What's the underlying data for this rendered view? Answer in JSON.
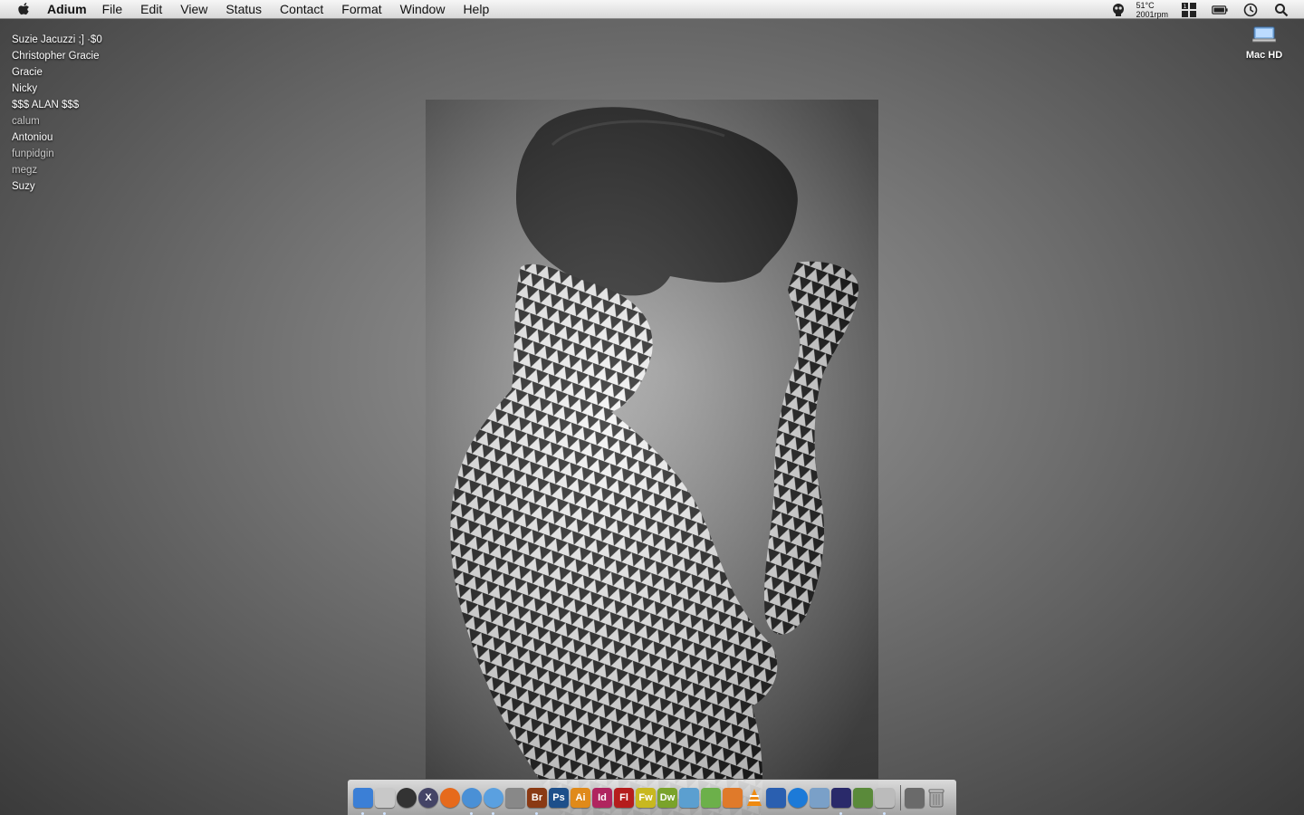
{
  "menubar": {
    "app_name": "Adium",
    "items": [
      "File",
      "Edit",
      "View",
      "Status",
      "Contact",
      "Format",
      "Window",
      "Help"
    ],
    "temp": "51°C",
    "rpm": "2001rpm"
  },
  "contacts": [
    {
      "name": "Suzie Jacuzzi ;] ·$0",
      "idle": false
    },
    {
      "name": "Christopher Gracie",
      "idle": false
    },
    {
      "name": "Gracie",
      "idle": false
    },
    {
      "name": "Nicky",
      "idle": false
    },
    {
      "name": "$$$ ALAN $$$",
      "idle": false
    },
    {
      "name": "calum",
      "idle": true
    },
    {
      "name": "Antoniou",
      "idle": false
    },
    {
      "name": "funpidgin",
      "idle": true
    },
    {
      "name": "megz",
      "idle": true
    },
    {
      "name": "Suzy",
      "idle": false
    }
  ],
  "desktop": {
    "drive_label": "Mac HD"
  },
  "dock": {
    "apps": [
      {
        "icon": "finder-icon",
        "label": "",
        "color": "#3b7fd6",
        "running": true
      },
      {
        "icon": "mail-stamp-icon",
        "label": "",
        "color": "#c8c8c8",
        "running": true
      },
      {
        "icon": "dashboard-icon",
        "label": "",
        "color": "#333333",
        "running": false
      },
      {
        "icon": "xcode-icon",
        "label": "",
        "color": "#444466",
        "running": false
      },
      {
        "icon": "firefox-icon",
        "label": "",
        "color": "#e66a1c",
        "running": false
      },
      {
        "icon": "safari-icon",
        "label": "",
        "color": "#4a90d6",
        "running": true
      },
      {
        "icon": "itunes-icon",
        "label": "",
        "color": "#5aa0e0",
        "running": true
      },
      {
        "icon": "system-preferences-icon",
        "label": "",
        "color": "#888888",
        "running": false
      },
      {
        "icon": "bridge-icon",
        "label": "Br",
        "color": "#8a3a14",
        "running": true
      },
      {
        "icon": "photoshop-icon",
        "label": "Ps",
        "color": "#1d4f8a",
        "running": false
      },
      {
        "icon": "illustrator-icon",
        "label": "Ai",
        "color": "#e08a1a",
        "running": false
      },
      {
        "icon": "indesign-icon",
        "label": "Id",
        "color": "#b0245f",
        "running": false
      },
      {
        "icon": "flash-icon",
        "label": "Fl",
        "color": "#b51d1d",
        "running": false
      },
      {
        "icon": "fireworks-icon",
        "label": "Fw",
        "color": "#c8b820",
        "running": false
      },
      {
        "icon": "dreamweaver-icon",
        "label": "Dw",
        "color": "#7aa32a",
        "running": false
      },
      {
        "icon": "adium-duck-icon",
        "label": "",
        "color": "#5b9fd0",
        "running": false
      },
      {
        "icon": "twitter-bird-icon",
        "label": "",
        "color": "#6cb04a",
        "running": false
      },
      {
        "icon": "scissors-icon",
        "label": "",
        "color": "#e07a2a",
        "running": false
      },
      {
        "icon": "vlc-icon",
        "label": "",
        "color": "#ef8a10",
        "running": false
      },
      {
        "icon": "transmit-icon",
        "label": "",
        "color": "#2a5fb0",
        "running": false
      },
      {
        "icon": "quicktime-icon",
        "label": "",
        "color": "#1c7ad8",
        "running": false
      },
      {
        "icon": "preview-icon",
        "label": "",
        "color": "#7aa0c8",
        "running": false
      },
      {
        "icon": "penguin-icon",
        "label": "",
        "color": "#2a2a6a",
        "running": true
      },
      {
        "icon": "hammer-icon",
        "label": "",
        "color": "#5a8a3a",
        "running": false
      },
      {
        "icon": "photos-icon",
        "label": "",
        "color": "#bbbbbb",
        "running": true
      },
      {
        "icon": "documents-stack-icon",
        "label": "",
        "color": "#6a6a6a",
        "running": false
      },
      {
        "icon": "trash-icon",
        "label": "",
        "color": "#999999",
        "running": false
      }
    ]
  }
}
